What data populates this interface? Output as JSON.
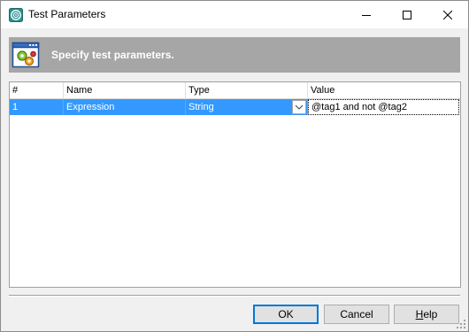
{
  "window": {
    "title": "Test Parameters",
    "app_icon": "gear-target-icon"
  },
  "banner": {
    "text": "Specify test parameters.",
    "icon": "window-gears-icon"
  },
  "grid": {
    "columns": [
      "#",
      "Name",
      "Type",
      "Value"
    ],
    "rows": [
      {
        "num": "1",
        "name": "Expression",
        "type": "String",
        "value": "@tag1 and not @tag2"
      }
    ],
    "selection_color": "#3399ff"
  },
  "buttons": {
    "ok": "OK",
    "cancel": "Cancel",
    "help_prefix": "",
    "help_underlined": "H",
    "help_suffix": "elp"
  },
  "colors": {
    "banner_bg": "#a6a6a6",
    "accent": "#0078d7"
  }
}
